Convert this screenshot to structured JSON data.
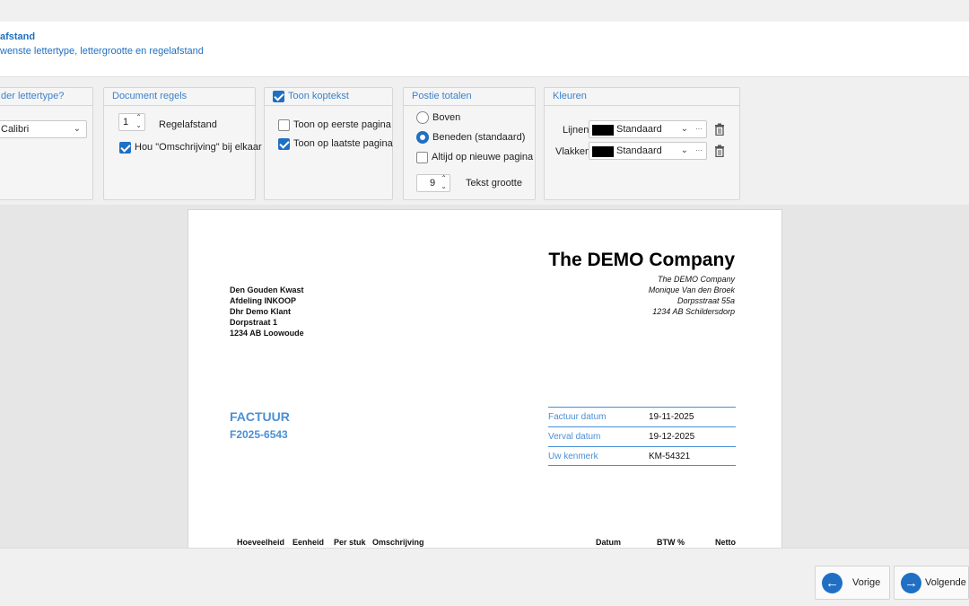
{
  "header": {
    "title": "afstand",
    "subtitle": "wenste lettertype, lettergrootte en regelafstand"
  },
  "panels": {
    "font": {
      "title": "der lettertype?",
      "font_value": "Calibri"
    },
    "document_rules": {
      "title": "Document regels",
      "spacing_value": "1",
      "spacing_label": "Regelafstand",
      "keep_together_label": "Hou \"Omschrijving\" bij elkaar",
      "keep_together_checked": true
    },
    "header_text": {
      "title": "Toon koptekst",
      "title_checked": true,
      "first_page_label": "Toon op eerste pagina",
      "first_page_checked": false,
      "last_page_label": "Toon op laatste pagina",
      "last_page_checked": true
    },
    "totals": {
      "title": "Postie totalen",
      "top_label": "Boven",
      "bottom_label": "Beneden (standaard)",
      "selected": "bottom",
      "new_page_label": "Altijd op nieuwe pagina",
      "new_page_checked": false,
      "size_value": "9",
      "size_label": "Tekst grootte"
    },
    "colors": {
      "title": "Kleuren",
      "lines_label": "Lijnen",
      "lines_value": "Standaard",
      "fills_label": "Vlakken",
      "fills_value": "Standaard",
      "swatch_color": "#000000",
      "more_glyph": "···"
    }
  },
  "invoice": {
    "company_name": "The DEMO Company",
    "company_lines": [
      "The DEMO Company",
      "Monique Van den Broek",
      "Dorpsstraat 55a",
      "1234 AB  Schildersdorp"
    ],
    "recipient_lines": [
      "Den Gouden Kwast",
      "Afdeling INKOOP",
      "Dhr Demo Klant",
      "Dorpstraat 1",
      "1234 AB  Loowoude"
    ],
    "doc_type": "FACTUUR",
    "doc_number": "F2025-6543",
    "meta": [
      {
        "label": "Factuur datum",
        "value": "19-11-2025"
      },
      {
        "label": "Verval datum",
        "value": "19-12-2025"
      },
      {
        "label": "Uw kenmerk",
        "value": "KM-54321"
      }
    ],
    "columns": [
      "Hoeveelheid",
      "Eenheid",
      "Per stuk",
      "Omschrijving",
      "Datum",
      "BTW %",
      "Netto"
    ],
    "accent_color": "#4a8fd6"
  },
  "footer": {
    "prev_label": "Vorige",
    "next_label": "Volgende",
    "prev_icon": "arrow-left-icon",
    "next_icon": "arrow-right-icon"
  }
}
